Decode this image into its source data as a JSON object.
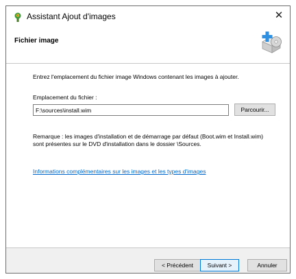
{
  "window": {
    "title": "Assistant Ajout d'images",
    "close_symbol": "✕",
    "app_icon": "wizard-app-icon"
  },
  "header": {
    "title": "Fichier image",
    "image_icon": "image-add-icon"
  },
  "content": {
    "instruction": "Entrez l'emplacement du fichier image Windows contenant les images à ajouter.",
    "file_label": "Emplacement du fichier :",
    "file_value": "F:\\sources\\install.wim",
    "browse_label": "Parcourir...",
    "remark": "Remarque : les images d'installation et de démarrage par défaut (Boot.wim et Install.wim) sont présentes sur le DVD d'installation dans le dossier \\Sources.",
    "link": "Informations complémentaires sur les images et les types d'images"
  },
  "footer": {
    "prev_label": "< Précédent",
    "next_label": "Suivant >",
    "cancel_label": "Annuler"
  }
}
